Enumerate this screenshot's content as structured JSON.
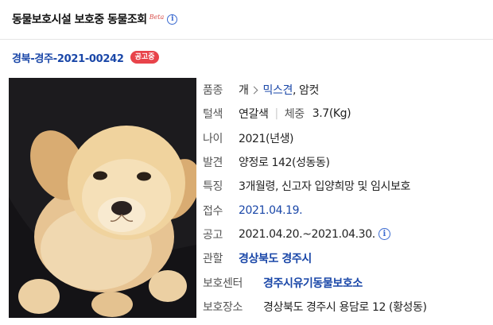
{
  "header": {
    "title": "동물보호시설 보호중 동물조회",
    "beta": "Beta"
  },
  "notice": {
    "id": "경북-경주-2021-00242",
    "status": "공고중"
  },
  "details": {
    "breed": {
      "label": "품종",
      "species": "개",
      "breed": "믹스견",
      "sex": ", 암컷"
    },
    "color": {
      "label": "털색",
      "value": "연갈색",
      "weight_label": "체중",
      "weight": "3.7(Kg)"
    },
    "age": {
      "label": "나이",
      "value": "2021(년생)"
    },
    "found": {
      "label": "발견",
      "value": "양정로 142(성동동)"
    },
    "features": {
      "label": "특징",
      "value": "3개월령, 신고자 입양희망 및 임시보호"
    },
    "received": {
      "label": "접수",
      "value": "2021.04.19."
    },
    "notice_period": {
      "label": "공고",
      "value": "2021.04.20.~2021.04.30."
    },
    "jurisdiction": {
      "label": "관할",
      "value": "경상북도 경주시"
    },
    "shelter": {
      "label": "보호센터",
      "value": "경주시유기동물보호소"
    },
    "location": {
      "label": "보호장소",
      "value": "경상북도 경주시 용담로 12 (황성동)"
    }
  },
  "colors": {
    "accent": "#1a47a8",
    "badge": "#e8434a",
    "beta": "#d9534f"
  }
}
